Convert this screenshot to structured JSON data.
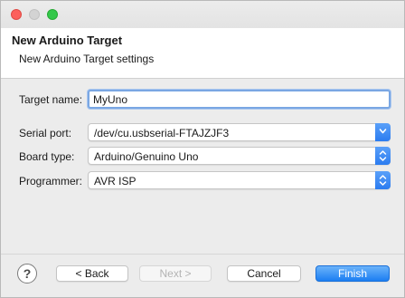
{
  "window": {
    "title_bar_buttons": [
      "close",
      "minimize",
      "maximize"
    ]
  },
  "header": {
    "title": "New Arduino Target",
    "description": "New Arduino Target settings"
  },
  "form": {
    "target_name": {
      "label": "Target name:",
      "value": "MyUno"
    },
    "serial_port": {
      "label": "Serial port:",
      "value": "/dev/cu.usbserial-FTAJZJF3"
    },
    "board_type": {
      "label": "Board type:",
      "value": "Arduino/Genuino Uno"
    },
    "programmer": {
      "label": "Programmer:",
      "value": "AVR ISP"
    }
  },
  "footer": {
    "help_label": "?",
    "back_label": "< Back",
    "next_label": "Next >",
    "cancel_label": "Cancel",
    "finish_label": "Finish"
  },
  "colors": {
    "accent": "#2b7cf0",
    "close": "#fc605c",
    "maximize": "#34c84a"
  }
}
